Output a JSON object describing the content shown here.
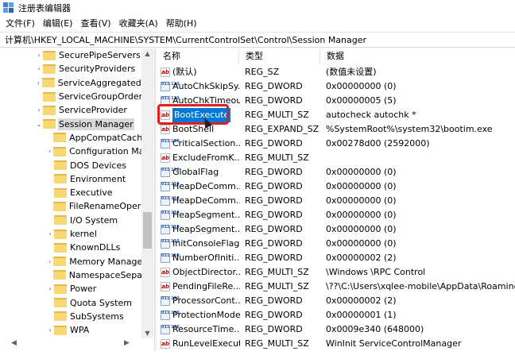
{
  "window": {
    "title": "注册表编辑器",
    "icon": "registry-editor-icon"
  },
  "menu": [
    "文件(F)",
    "编辑(E)",
    "查看(V)",
    "收藏夹(A)",
    "帮助(H)"
  ],
  "address": "计算机\\HKEY_LOCAL_MACHINE\\SYSTEM\\CurrentControlSet\\Control\\Session Manager",
  "tree": [
    {
      "label": "SecurePipeServers",
      "chevron": "›"
    },
    {
      "label": "SecurityProviders",
      "chevron": "›"
    },
    {
      "label": "ServiceAggregatedEv",
      "chevron": "›"
    },
    {
      "label": "ServiceGroupOrder",
      "chevron": ""
    },
    {
      "label": "ServiceProvider",
      "chevron": "›"
    },
    {
      "label": "Session Manager",
      "chevron": "⌄",
      "selected": true
    },
    {
      "label": "AppCompatCache",
      "chevron": ""
    },
    {
      "label": "Configuration Mar",
      "chevron": "›"
    },
    {
      "label": "DOS Devices",
      "chevron": ""
    },
    {
      "label": "Environment",
      "chevron": ""
    },
    {
      "label": "Executive",
      "chevron": ""
    },
    {
      "label": "FileRenameOperat",
      "chevron": ""
    },
    {
      "label": "I/O System",
      "chevron": ""
    },
    {
      "label": "kernel",
      "chevron": "›"
    },
    {
      "label": "KnownDLLs",
      "chevron": ""
    },
    {
      "label": "Memory Manager",
      "chevron": "›"
    },
    {
      "label": "NamespaceSepara",
      "chevron": ""
    },
    {
      "label": "Power",
      "chevron": "›"
    },
    {
      "label": "Quota System",
      "chevron": ""
    },
    {
      "label": "SubSystems",
      "chevron": ""
    },
    {
      "label": "WPA",
      "chevron": "›"
    }
  ],
  "columns": {
    "name": "名称",
    "type": "类型",
    "data": "数据"
  },
  "values": [
    {
      "icon": "ab",
      "name": "(默认)",
      "type": "REG_SZ",
      "data": "(数值未设置)"
    },
    {
      "icon": "bin",
      "name": "AutoChkSkipSy...",
      "type": "REG_DWORD",
      "data": "0x00000000 (0)"
    },
    {
      "icon": "bin",
      "name": "AutoChkTimeout",
      "type": "REG_DWORD",
      "data": "0x00000005 (5)"
    },
    {
      "icon": "ab",
      "name": "BootExecute",
      "type": "REG_MULTI_SZ",
      "data": "autocheck autochk *",
      "selected": true
    },
    {
      "icon": "ab",
      "name": "BootShell",
      "type": "REG_EXPAND_SZ",
      "data": "%SystemRoot%\\system32\\bootim.exe"
    },
    {
      "icon": "bin",
      "name": "CriticalSection...",
      "type": "REG_DWORD",
      "data": "0x00278d00 (2592000)"
    },
    {
      "icon": "ab",
      "name": "ExcludeFromK...",
      "type": "REG_MULTI_SZ",
      "data": ""
    },
    {
      "icon": "bin",
      "name": "GlobalFlag",
      "type": "REG_DWORD",
      "data": "0x00000000 (0)"
    },
    {
      "icon": "bin",
      "name": "HeapDeComm...",
      "type": "REG_DWORD",
      "data": "0x00000000 (0)"
    },
    {
      "icon": "bin",
      "name": "HeapDeComm...",
      "type": "REG_DWORD",
      "data": "0x00000000 (0)"
    },
    {
      "icon": "bin",
      "name": "HeapSegment...",
      "type": "REG_DWORD",
      "data": "0x00000000 (0)"
    },
    {
      "icon": "bin",
      "name": "HeapSegment...",
      "type": "REG_DWORD",
      "data": "0x00000000 (0)"
    },
    {
      "icon": "bin",
      "name": "InitConsoleFlags",
      "type": "REG_DWORD",
      "data": "0x00000000 (0)"
    },
    {
      "icon": "bin",
      "name": "NumberOfIniti...",
      "type": "REG_DWORD",
      "data": "0x00000002 (2)"
    },
    {
      "icon": "ab",
      "name": "ObjectDirector...",
      "type": "REG_MULTI_SZ",
      "data": "\\Windows \\RPC Control"
    },
    {
      "icon": "ab",
      "name": "PendingFileRe...",
      "type": "REG_MULTI_SZ",
      "data": "\\??\\C:\\Users\\xqlee-mobile\\AppData\\Roaming..."
    },
    {
      "icon": "bin",
      "name": "ProcessorCont...",
      "type": "REG_DWORD",
      "data": "0x00000002 (2)"
    },
    {
      "icon": "bin",
      "name": "ProtectionMode",
      "type": "REG_DWORD",
      "data": "0x00000001 (1)"
    },
    {
      "icon": "bin",
      "name": "ResourceTime...",
      "type": "REG_DWORD",
      "data": "0x0009e340 (648000)"
    },
    {
      "icon": "ab",
      "name": "RunLevelExecute",
      "type": "REG_MULTI_SZ",
      "data": "WinInit ServiceControlManager"
    }
  ],
  "colors": {
    "selection": "#0078d7",
    "highlight_box": "#e02020",
    "folder": "#f8d775"
  }
}
